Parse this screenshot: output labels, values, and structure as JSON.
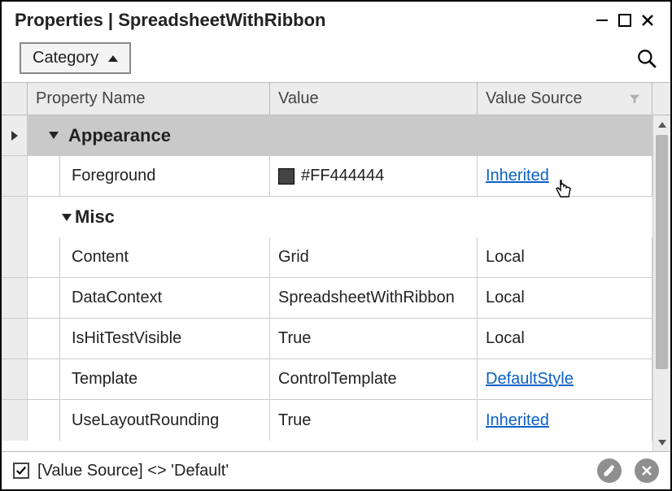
{
  "window": {
    "title": "Properties | SpreadsheetWithRibbon"
  },
  "toolbar": {
    "group_label": "Category"
  },
  "columns": {
    "name": "Property Name",
    "value": "Value",
    "source": "Value Source"
  },
  "groups": {
    "appearance": {
      "label": "Appearance",
      "rows": {
        "foreground": {
          "name": "Foreground",
          "value": "#FF444444",
          "swatch": "#444444",
          "source": "Inherited",
          "source_is_link": true
        }
      }
    },
    "misc": {
      "label": "Misc",
      "rows": {
        "content": {
          "name": "Content",
          "value": "Grid",
          "source": "Local",
          "source_is_link": false
        },
        "datacontext": {
          "name": "DataContext",
          "value": "SpreadsheetWithRibbon",
          "source": "Local",
          "source_is_link": false
        },
        "ishittestvisible": {
          "name": "IsHitTestVisible",
          "value": "True",
          "source": "Local",
          "source_is_link": false
        },
        "template": {
          "name": "Template",
          "value": "ControlTemplate",
          "source": "DefaultStyle",
          "source_is_link": true
        },
        "uselayoutrounding": {
          "name": "UseLayoutRounding",
          "value": "True",
          "source": "Inherited",
          "source_is_link": true
        }
      }
    }
  },
  "footer": {
    "filter_text": "[Value Source] <> 'Default'",
    "checked": true
  }
}
